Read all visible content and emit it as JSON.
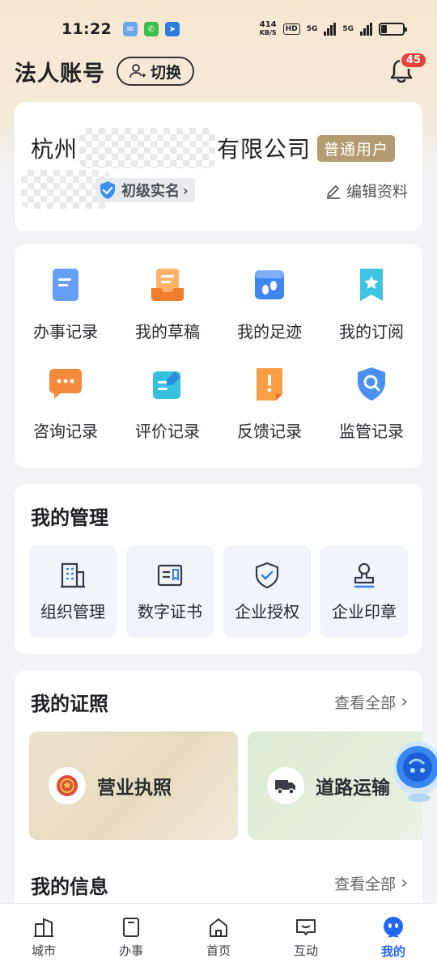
{
  "status_bar": {
    "time": "11:22",
    "net_speed": "414",
    "net_unit": "KB/S",
    "hd_label": "HD",
    "signal1_label": "5G",
    "signal2_label": "5G"
  },
  "header": {
    "title": "法人账号",
    "switch_label": "切换",
    "notification_count": "45"
  },
  "profile": {
    "company_prefix": "杭州",
    "company_suffix": "有限公司",
    "user_type": "普通用户",
    "verify_label": "初级实名",
    "edit_label": "编辑资料"
  },
  "records": {
    "items": [
      {
        "label": "办事记录",
        "icon": "clipboard-icon"
      },
      {
        "label": "我的草稿",
        "icon": "draft-tray-icon"
      },
      {
        "label": "我的足迹",
        "icon": "footprint-icon"
      },
      {
        "label": "我的订阅",
        "icon": "bookmark-star-icon"
      },
      {
        "label": "咨询记录",
        "icon": "chat-bubble-icon"
      },
      {
        "label": "评价记录",
        "icon": "pencil-note-icon"
      },
      {
        "label": "反馈记录",
        "icon": "exclamation-note-icon"
      },
      {
        "label": "监管记录",
        "icon": "shield-search-icon"
      }
    ]
  },
  "management": {
    "title": "我的管理",
    "items": [
      {
        "label": "组织管理",
        "icon": "building-icon"
      },
      {
        "label": "数字证书",
        "icon": "certificate-icon"
      },
      {
        "label": "企业授权",
        "icon": "shield-check-icon"
      },
      {
        "label": "企业印章",
        "icon": "stamp-icon"
      }
    ]
  },
  "licenses": {
    "title": "我的证照",
    "view_all": "查看全部",
    "items": [
      {
        "label": "营业执照",
        "icon": "national-emblem-icon"
      },
      {
        "label": "道路运输",
        "icon": "truck-icon"
      }
    ]
  },
  "info": {
    "title": "我的信息",
    "view_all": "查看全部"
  },
  "bottom_nav": {
    "items": [
      {
        "label": "城市",
        "icon": "city-icon",
        "active": false
      },
      {
        "label": "办事",
        "icon": "document-icon",
        "active": false
      },
      {
        "label": "首页",
        "icon": "home-icon",
        "active": false
      },
      {
        "label": "互动",
        "icon": "message-icon",
        "active": false
      },
      {
        "label": "我的",
        "icon": "profile-icon",
        "active": true
      }
    ]
  },
  "colors": {
    "accent": "#2166f5",
    "badge": "#e8413a",
    "user_type_bg": "#b49b71"
  }
}
